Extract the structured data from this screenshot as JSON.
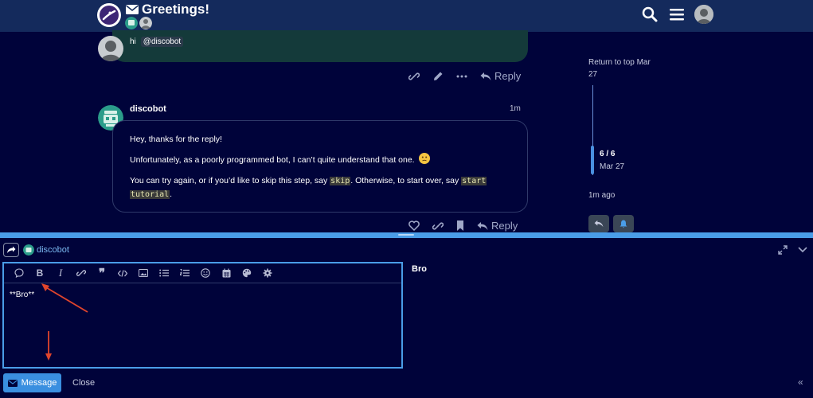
{
  "header": {
    "title": "Greetings!",
    "icons": [
      "site-logo",
      "envelope-icon",
      "search-icon",
      "hamburger-icon",
      "user-avatar"
    ]
  },
  "post1": {
    "text": "hi",
    "mention": "@discobot",
    "actions": {
      "reply_label": "Reply"
    }
  },
  "post2": {
    "username": "discobot",
    "time": "1m",
    "p1": "Hey, thanks for the reply!",
    "p2": "Unfortunately, as a poorly programmed bot, I can’t quite understand that one.",
    "p3_a": "You can try again, or if you’d like to skip this step, say ",
    "p3_code1": "skip",
    "p3_b": ". Otherwise, to start over, say ",
    "p3_code2a": "start",
    "p3_code2b": "tutorial",
    "p3_c": ".",
    "actions": {
      "reply_label": "Reply"
    }
  },
  "timeline": {
    "return_label": "Return to top Mar",
    "return_day": "27",
    "position": "6 / 6",
    "date": "Mar 27",
    "ago": "1m ago"
  },
  "composer": {
    "recipient": "discobot",
    "editor_text": "**Bro**",
    "preview_text": "Bro",
    "send_label": "Message",
    "close_label": "Close",
    "collapse_glyph": "«"
  },
  "colors": {
    "background": "#00033a",
    "header": "#142a5c",
    "accent": "#4a9de8",
    "annotation": "#e0452c"
  }
}
